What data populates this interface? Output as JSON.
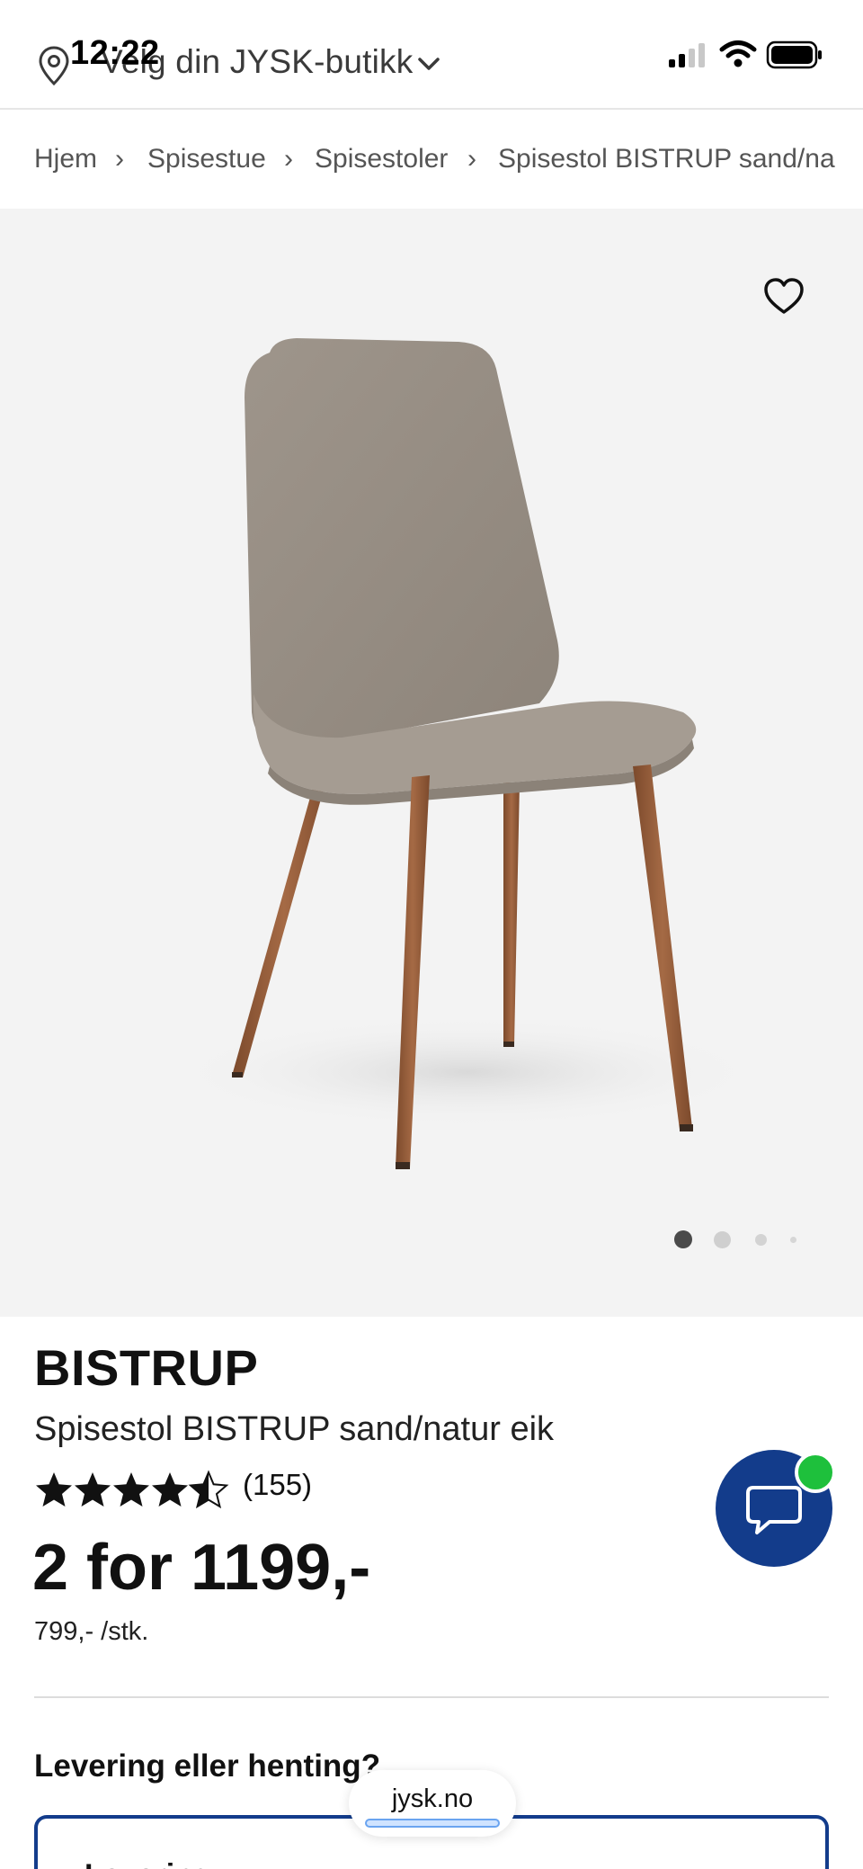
{
  "status_bar": {
    "time": "12:22"
  },
  "header": {
    "store_selector_label": "Velg din JYSK-butikk"
  },
  "breadcrumb": {
    "items": [
      "Hjem",
      "Spisestue",
      "Spisestoler",
      "Spisestol BISTRUP sand/na"
    ],
    "separator": "›"
  },
  "gallery": {
    "image_count": 4,
    "active_index": 0
  },
  "product": {
    "brand": "BISTRUP",
    "name": "Spisestol BISTRUP sand/natur eik",
    "rating": 4.5,
    "rating_max": 5,
    "review_count": "(155)",
    "price": "2 for 1199,-",
    "unit_price": "799,- /stk."
  },
  "delivery": {
    "heading": "Levering eller henting?",
    "option_label": "Levering"
  },
  "browser": {
    "url": "jysk.no"
  },
  "colors": {
    "brand_blue": "#133c8b",
    "online_green": "#1ec03c",
    "hero_bg": "#f3f3f3",
    "chair_fabric": "#a39a90",
    "chair_legs": "#9a5c38"
  }
}
